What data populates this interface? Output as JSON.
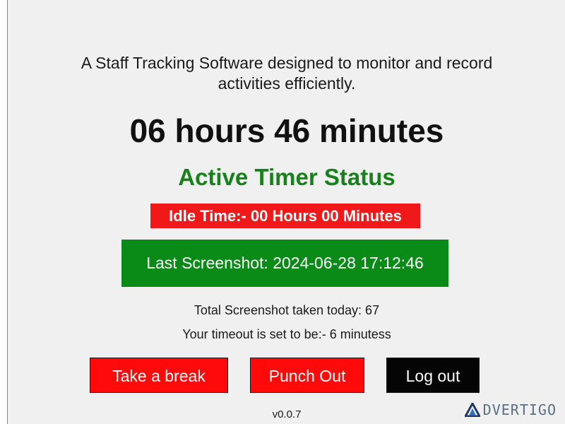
{
  "description": {
    "line1": "A Staff Tracking Software designed to monitor and record",
    "line2": "activities efficiently."
  },
  "worked_time": "06 hours 46 minutes",
  "timer_status": "Active Timer Status",
  "idle_time": "Idle Time:- 00 Hours 00 Minutes",
  "last_screenshot": "Last Screenshot: 2024-06-28 17:12:46",
  "total_screenshots": "Total Screenshot taken today: 67",
  "timeout": "Your timeout is set to be:- 6 minutess",
  "buttons": {
    "take_break": "Take a break",
    "punch_out": "Punch Out",
    "log_out": "Log out"
  },
  "version": "v0.0.7",
  "watermark": {
    "text": "DVERTIGO",
    "icon": "triangle-logo-icon"
  },
  "colors": {
    "status_green": "#17821a",
    "idle_red": "#f01818",
    "screenshot_green": "#0a8a16",
    "button_red": "#ff0a0a",
    "button_black": "#050505"
  }
}
